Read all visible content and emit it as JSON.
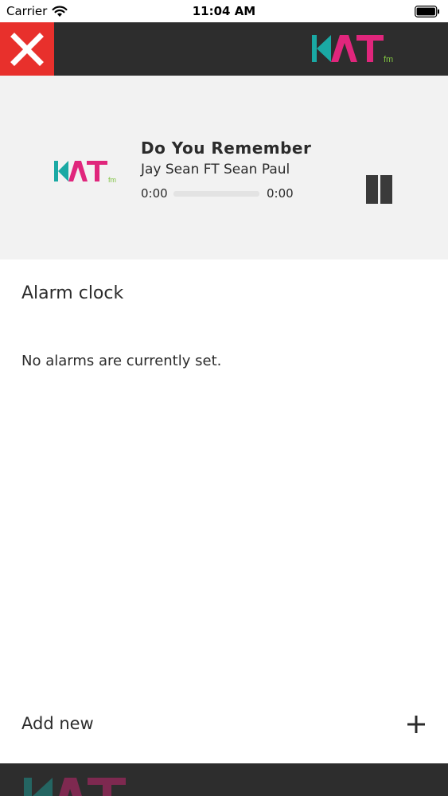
{
  "status_bar": {
    "carrier": "Carrier",
    "time": "11:04 AM",
    "icons": [
      "wifi-icon",
      "battery-icon"
    ]
  },
  "top_nav": {
    "close_icon": "close-icon",
    "logo_icon": "kat-fm-logo",
    "close_color": "#e8302c",
    "bar_color": "#2d2d2d"
  },
  "now_playing": {
    "title": "Do You Remember",
    "artist": "Jay Sean FT Sean Paul",
    "time_elapsed": "0:00",
    "time_total": "0:00",
    "progress": 0,
    "control_icon": "pause-icon",
    "station_logo_icon": "kat-fm-logo"
  },
  "alarms": {
    "section_title": "Alarm clock",
    "empty_message": "No alarms are currently set.",
    "add_label": "Add new",
    "add_icon": "plus-icon"
  },
  "brand": {
    "logo_text": "KAT",
    "logo_suffix": "fm",
    "colors": {
      "teal": "#1aa9a4",
      "magenta": "#e0267c",
      "green": "#7fc241"
    }
  }
}
